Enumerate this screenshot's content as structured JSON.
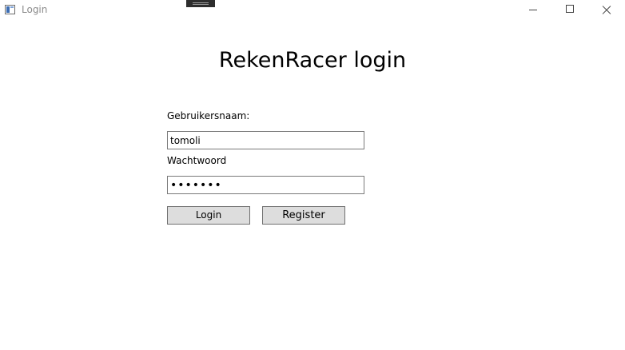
{
  "window": {
    "title": "Login",
    "controls": {
      "minimize": "minimize-icon",
      "maximize": "maximize-icon",
      "close": "close-icon"
    }
  },
  "form": {
    "heading": "RekenRacer login",
    "username_label": "Gebruikersnaam:",
    "username_value": "tomoli",
    "password_label": "Wachtwoord",
    "password_value": "•••••••",
    "login_label": "Login",
    "register_label": "Register"
  }
}
